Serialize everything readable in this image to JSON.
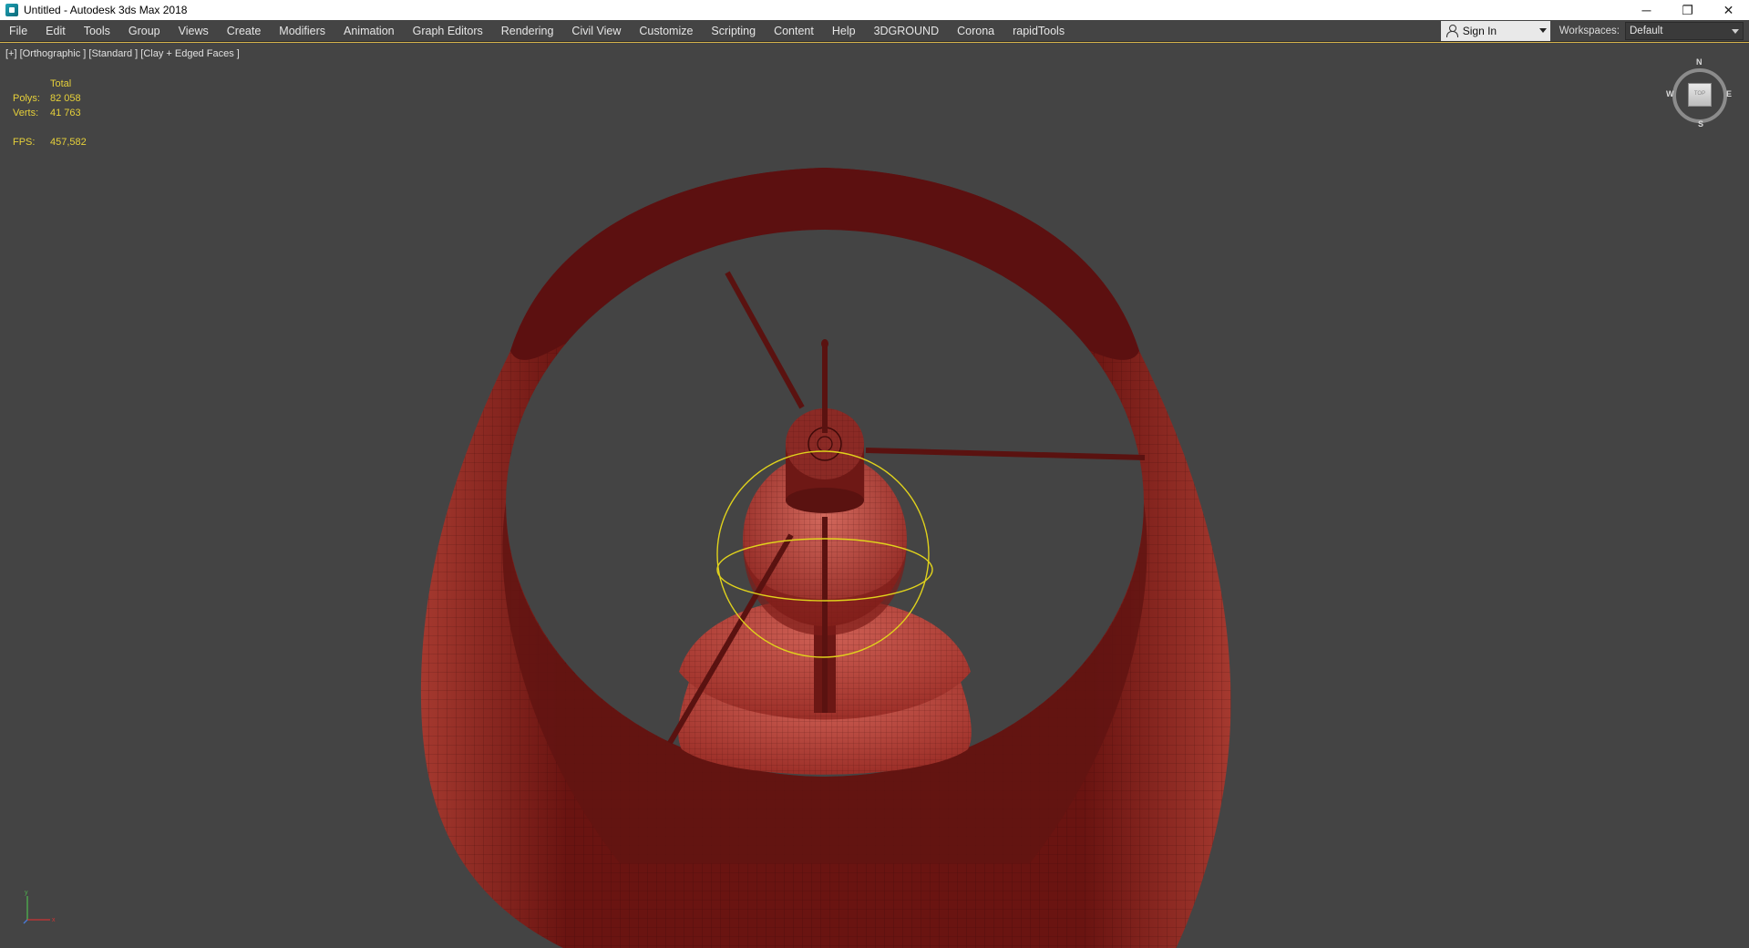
{
  "window": {
    "title": "Untitled - Autodesk 3ds Max 2018",
    "controls": [
      "─",
      "❐",
      "✕"
    ]
  },
  "menu": {
    "items": [
      "File",
      "Edit",
      "Tools",
      "Group",
      "Views",
      "Create",
      "Modifiers",
      "Animation",
      "Graph Editors",
      "Rendering",
      "Civil View",
      "Customize",
      "Scripting",
      "Content",
      "Help",
      "3DGROUND",
      "Corona",
      "rapidTools"
    ],
    "sign_in": "Sign In",
    "workspaces_label": "Workspaces:",
    "workspace_value": "Default"
  },
  "viewport": {
    "label": "[+] [Orthographic ] [Standard ] [Clay + Edged Faces ]",
    "stats": {
      "total_label": "Total",
      "polys_label": "Polys:",
      "polys_value": "82 058",
      "verts_label": "Verts:",
      "verts_value": "41 763",
      "fps_label": "FPS:",
      "fps_value": "457,582"
    },
    "viewcube": {
      "n": "N",
      "s": "S",
      "e": "E",
      "w": "W",
      "face": "TOP"
    },
    "colors": {
      "background": "#444444",
      "shade_dark": "#5e1010",
      "shade_mid": "#8a2a26",
      "shade_light": "#c24f45",
      "selection": "#e0d21c",
      "stats_text": "#e6d03a"
    }
  }
}
